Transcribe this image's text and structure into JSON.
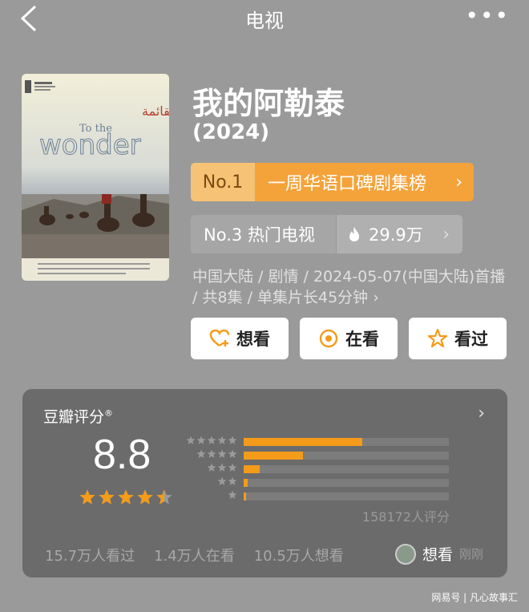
{
  "header": {
    "title": "电视"
  },
  "poster": {
    "title_line1": "To the",
    "title_line2": "wonder",
    "arabic_logo": "القائمة"
  },
  "movie": {
    "title": "我的阿勒泰",
    "year": "(2024)"
  },
  "rank_weekly": {
    "number": "No.1",
    "label": "一周华语口碑剧集榜"
  },
  "rank_hot": {
    "label": "No.3 热门电视",
    "heat": "29.9万"
  },
  "meta_text": "中国大陆 / 剧情 / 2024-05-07(中国大陆)首播 / 共8集 / 单集片长45分钟 ›",
  "actions": {
    "want": "想看",
    "watching": "在看",
    "watched": "看过"
  },
  "rating": {
    "label": "豆瓣评分",
    "mark": "®",
    "score": "8.8",
    "stars_value": 4.5,
    "count": "158172人评分",
    "distribution": [
      {
        "stars": 5,
        "fraction": 0.58
      },
      {
        "stars": 4,
        "fraction": 0.29
      },
      {
        "stars": 3,
        "fraction": 0.08
      },
      {
        "stars": 2,
        "fraction": 0.02
      },
      {
        "stars": 1,
        "fraction": 0.01
      }
    ]
  },
  "stats": {
    "watched": "15.7万人看过",
    "watching": "1.4万人在看",
    "want": "10.5万人想看"
  },
  "recent": {
    "label": "想看",
    "time": "刚刚"
  },
  "watermark": "网易号 | 凡心故事汇",
  "colors": {
    "accent": "#f49b1a",
    "rank_bg": "#f4a33a"
  }
}
